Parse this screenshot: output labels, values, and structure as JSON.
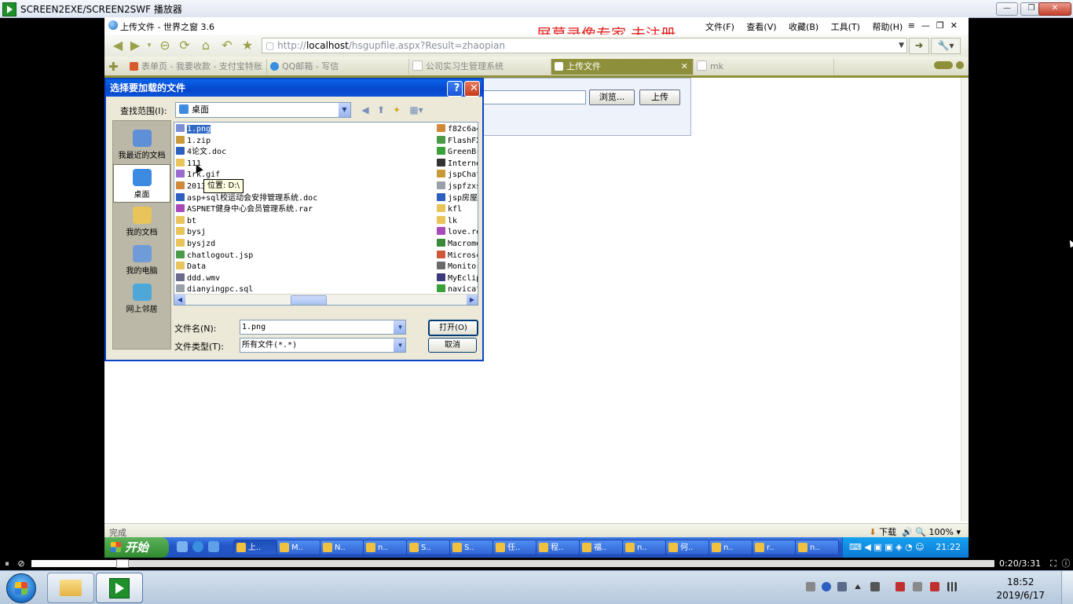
{
  "player": {
    "title": "SCREEN2EXE/SCREEN2SWF 播放器",
    "time": "0:20/3:31",
    "progress": 0.095,
    "controls": [
      "⏸",
      "⊘",
      "⛶",
      "ⓘ"
    ]
  },
  "browser": {
    "title": "上传文件 - 世界之窗 3.6",
    "menu": [
      "文件(F)",
      "查看(V)",
      "收藏(B)",
      "工具(T)",
      "帮助(H)"
    ],
    "watermark": "屏幕录像专家  未注册",
    "address_prefix": "http://",
    "address_host": "localhost",
    "address_path": "/hsgupfile.aspx?Result=zhaopian",
    "tabs": [
      {
        "label": "表单页 - 我要收款 - 支付宝特账",
        "color": "#d85a2a",
        "active": false
      },
      {
        "label": "QQ邮箱 - 写信",
        "color": "#3a8ee0",
        "active": false
      },
      {
        "label": "公司实习生管理系统",
        "color": "#bbbbbb",
        "active": false
      },
      {
        "label": "上传文件",
        "color": "#ffffff",
        "active": true
      },
      {
        "label": "mk",
        "color": "#bbbbbb",
        "active": false
      }
    ],
    "tab_close": "✕",
    "page": {
      "browse_label": "浏览...",
      "upload_label": "上传"
    },
    "status_text": "完成",
    "download_label": "下载",
    "zoom": "100%"
  },
  "dialog": {
    "title": "选择要加载的文件",
    "help": "?",
    "close": "✕",
    "look_in_label": "查找范围(I):",
    "look_in_value": "桌面",
    "places": [
      {
        "label": "我最近的文档",
        "color": "#5f8fd6"
      },
      {
        "label": "桌面",
        "color": "#3c8be0",
        "selected": true
      },
      {
        "label": "我的文档",
        "color": "#e8c45a"
      },
      {
        "label": "我的电脑",
        "color": "#6f9bd8"
      },
      {
        "label": "网上邻居",
        "color": "#4fa7d8"
      }
    ],
    "files_col1": [
      {
        "name": "1.png",
        "color": "#7b8fd6",
        "selected": true
      },
      {
        "name": "1.zip",
        "color": "#c89a3a"
      },
      {
        "name": "4论文.doc",
        "color": "#2d5fbf"
      },
      {
        "name": "111",
        "color": "#e8c45a"
      },
      {
        "name": "1rk.gif",
        "color": "#9a6ad0"
      },
      {
        "name": "2013        23.jpg",
        "color": "#d0883a"
      },
      {
        "name": "asp+sql校运动会安排管理系统.doc",
        "color": "#2d5fbf"
      },
      {
        "name": "ASPNET健身中心会员管理系统.rar",
        "color": "#a84ab8"
      },
      {
        "name": "bt",
        "color": "#e8c45a"
      },
      {
        "name": "bysj",
        "color": "#e8c45a"
      },
      {
        "name": "bysjzd",
        "color": "#e8c45a"
      },
      {
        "name": "chatlogout.jsp",
        "color": "#4a9a4a"
      },
      {
        "name": "Data",
        "color": "#e8c45a"
      },
      {
        "name": "ddd.wmv",
        "color": "#6a6a8a"
      },
      {
        "name": "dianyingpc.sql",
        "color": "#9aa0aa"
      }
    ],
    "files_col2": [
      {
        "name": "f82c6a4",
        "color": "#d0883a"
      },
      {
        "name": "FlashFX",
        "color": "#4a9a4a"
      },
      {
        "name": "GreenBr",
        "color": "#3aa03a"
      },
      {
        "name": "Interne",
        "color": "#333333"
      },
      {
        "name": "jspChat",
        "color": "#c89a3a"
      },
      {
        "name": "jspfzxs",
        "color": "#9aa0aa"
      },
      {
        "name": "jsp房屋",
        "color": "#2d5fbf"
      },
      {
        "name": "kfl",
        "color": "#e8c45a"
      },
      {
        "name": "lk",
        "color": "#e8c45a"
      },
      {
        "name": "love.re",
        "color": "#a84ab8"
      },
      {
        "name": "Macrome",
        "color": "#3a8a3a"
      },
      {
        "name": "Microsc",
        "color": "#d0583a"
      },
      {
        "name": "Monitor",
        "color": "#6a6a6a"
      },
      {
        "name": "MyEclip",
        "color": "#3a3a7a"
      },
      {
        "name": "navicat",
        "color": "#3aa03a"
      }
    ],
    "tooltip": "位置: D:\\",
    "filename_label": "文件名(N):",
    "filename_value": "1.png",
    "filetype_label": "文件类型(T):",
    "filetype_value": "所有文件(*.*)",
    "open_label": "打开(O)",
    "cancel_label": "取消"
  },
  "xp_taskbar": {
    "start_label": "开始",
    "tasks": [
      "上..",
      "M..",
      "N..",
      "n..",
      "S..",
      "S..",
      "任..",
      "程..",
      "福..",
      "n..",
      "何..",
      "n..",
      "r..",
      "n.."
    ],
    "time": "21:22"
  },
  "win7": {
    "time": "18:52",
    "date": "2019/6/17"
  }
}
